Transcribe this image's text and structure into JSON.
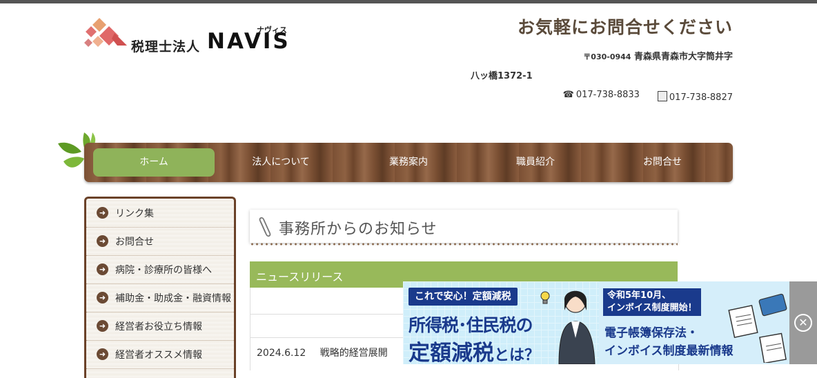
{
  "header": {
    "logo_firm": "税理士法人",
    "logo_name": "NAVIS",
    "logo_kana": "ナヴィス",
    "tagline": "お気軽にお問合せください",
    "zip": "〒030-0944",
    "address_line1": "青森県青森市大字筒井字",
    "address_line2": "八ッ橋1372-1",
    "tel_icon": "☎",
    "tel": "017-738-8833",
    "fax": "017-738-8827"
  },
  "nav": {
    "items": [
      {
        "label": "ホーム"
      },
      {
        "label": "法人について"
      },
      {
        "label": "業務案内"
      },
      {
        "label": "職員紹介"
      },
      {
        "label": "お問合せ"
      }
    ]
  },
  "sidebar": {
    "arrow": "➜",
    "items": [
      {
        "label": "リンク集"
      },
      {
        "label": "お問合せ"
      },
      {
        "label": "病院・診療所の皆様へ"
      },
      {
        "label": "補助金・助成金・融資情報"
      },
      {
        "label": "経営者お役立ち情報"
      },
      {
        "label": "経営者オススメ情報"
      }
    ]
  },
  "main": {
    "notice_title": "事務所からのお知らせ",
    "news_title": "ニュースリリース",
    "news": [
      {
        "date": "2024.6.12",
        "text": "戦略的経営展開"
      }
    ]
  },
  "banner": {
    "tag": "これで安心！定額減税",
    "line1": "所得税･住民税の",
    "line2_main": "定額減税",
    "line2_suffix": "とは？",
    "right_tag_1": "令和5年10月、",
    "right_tag_2": "インボイス制度開始！",
    "right_line1": "電子帳簿保存法・",
    "right_line2": "インボイス制度最新情報",
    "close_glyph": "✕"
  },
  "colors": {
    "nav_active": "#8fb35a",
    "news_bar": "#98b95a",
    "banner_navy": "#1a3a8c",
    "tagline": "#5a4a3a"
  }
}
